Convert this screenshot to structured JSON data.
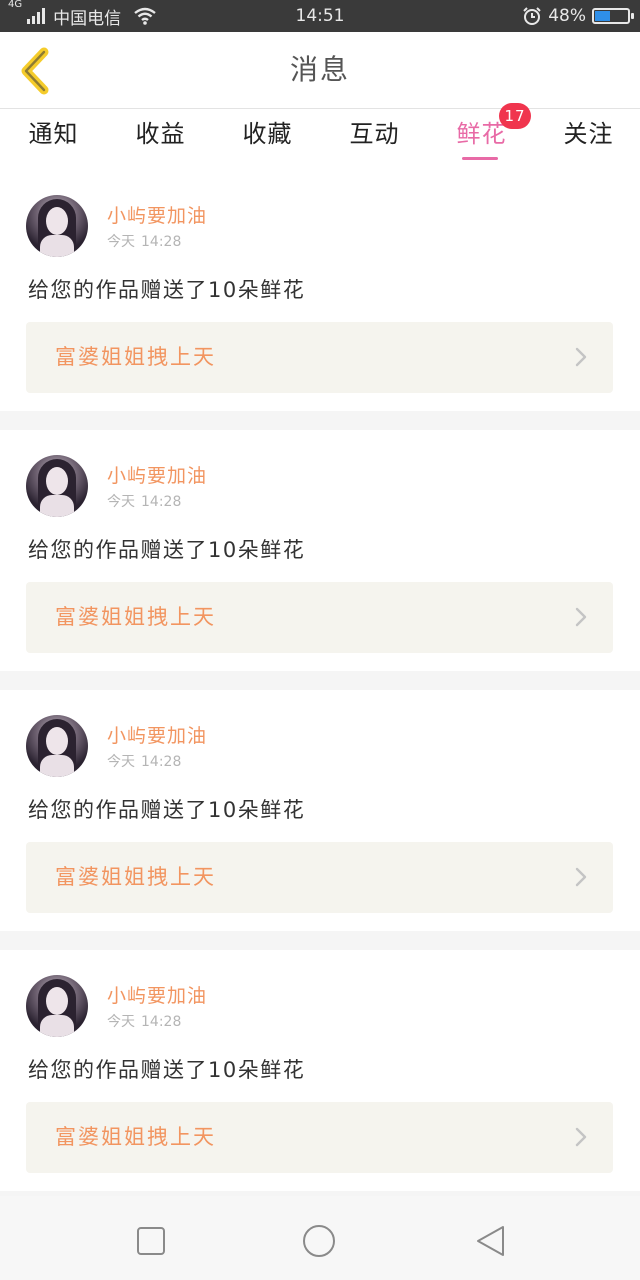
{
  "status_bar": {
    "network": "4G",
    "carrier": "中国电信",
    "time": "14:51",
    "battery": "48%",
    "battery_level": 0.48
  },
  "header": {
    "title": "消息"
  },
  "tabs": [
    {
      "label": "通知"
    },
    {
      "label": "收益"
    },
    {
      "label": "收藏"
    },
    {
      "label": "互动"
    },
    {
      "label": "鲜花",
      "active": true,
      "badge": "17"
    },
    {
      "label": "关注"
    }
  ],
  "messages": [
    {
      "username": "小屿要加油",
      "day": "今天",
      "time": "14:28",
      "text": "给您的作品赠送了10朵鲜花",
      "work_title": "富婆姐姐拽上天"
    },
    {
      "username": "小屿要加油",
      "day": "今天",
      "time": "14:28",
      "text": "给您的作品赠送了10朵鲜花",
      "work_title": "富婆姐姐拽上天"
    },
    {
      "username": "小屿要加油",
      "day": "今天",
      "time": "14:28",
      "text": "给您的作品赠送了10朵鲜花",
      "work_title": "富婆姐姐拽上天"
    },
    {
      "username": "小屿要加油",
      "day": "今天",
      "time": "14:28",
      "text": "给您的作品赠送了10朵鲜花",
      "work_title": "富婆姐姐拽上天"
    }
  ],
  "colors": {
    "accent_pink": "#e86aa6",
    "username_orange": "#f29560",
    "badge_red": "#f0354e",
    "back_yellow": "#f5cc2b"
  },
  "icons": {
    "back": "chevron-left-icon",
    "row": "chevron-right-icon",
    "nav": [
      "square-icon",
      "circle-icon",
      "triangle-back-icon"
    ]
  }
}
